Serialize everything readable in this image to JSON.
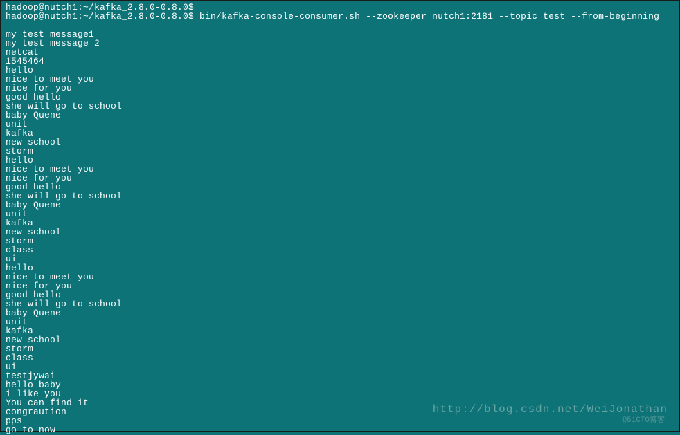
{
  "terminal": {
    "truncated_top": "hadoop@nutch1:~/kafka_2.8.0-0.8.0$",
    "prompt": "hadoop@nutch1:~/kafka_2.8.0-0.8.0$ bin/kafka-console-consumer.sh --zookeeper nutch1:2181 --topic test --from-beginning",
    "output_lines": [
      "my test message1",
      "my test message 2",
      "netcat",
      "1545464",
      "hello",
      "nice to meet you",
      "nice for you",
      "good hello",
      "she will go to school",
      "baby Quene",
      "unit",
      "kafka",
      "new school",
      "storm",
      "hello",
      "nice to meet you",
      "nice for you",
      "good hello",
      "she will go to school",
      "baby Quene",
      "unit",
      "kafka",
      "new school",
      "storm",
      "class",
      "ui",
      "hello",
      "nice to meet you",
      "nice for you",
      "good hello",
      "she will go to school",
      "baby Quene",
      "unit",
      "kafka",
      "new school",
      "storm",
      "class",
      "ui",
      "testjywai",
      "hello baby",
      "i like you",
      "You can find it",
      "congraution",
      "pps",
      "go to now"
    ]
  },
  "watermark": {
    "url": "http://blog.csdn.net/WeiJonathan",
    "logo": "@51CTO博客"
  }
}
